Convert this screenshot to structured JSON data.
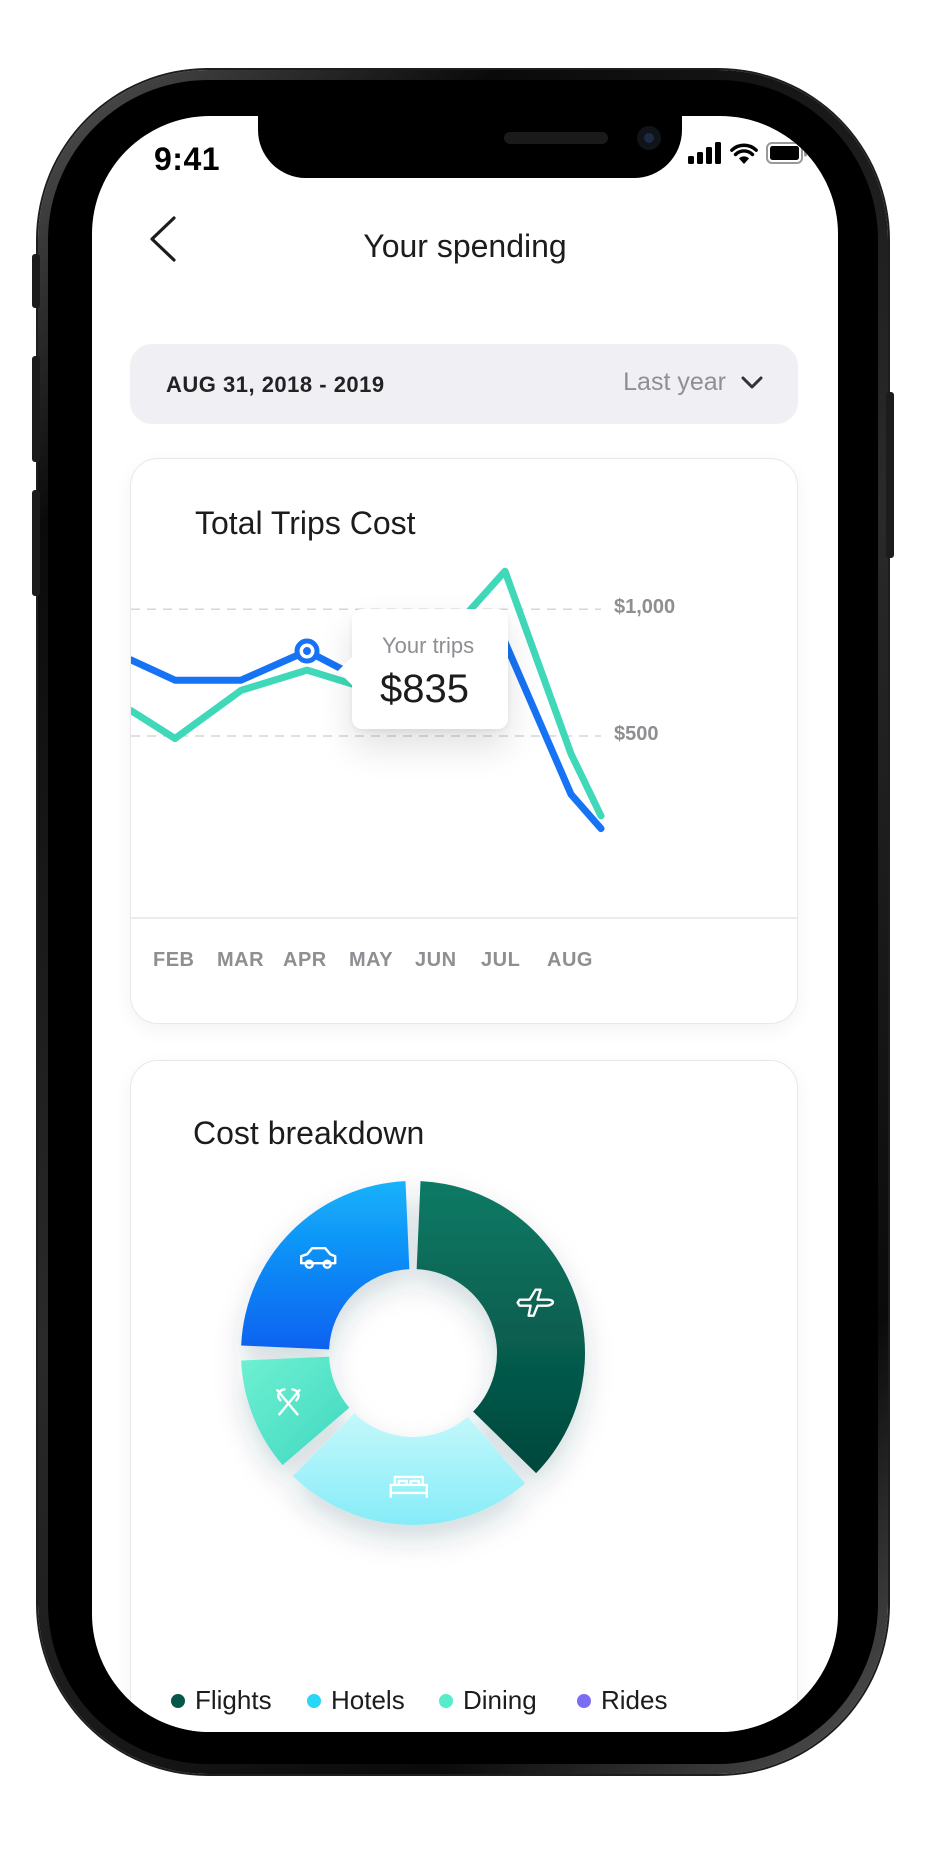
{
  "status_bar": {
    "time": "9:41"
  },
  "nav": {
    "title": "Your spending"
  },
  "date_range": {
    "label": "AUG 31, 2018 - 2019",
    "selected": "Last year"
  },
  "trips_card": {
    "title": "Total Trips Cost",
    "tooltip": {
      "label": "Your trips",
      "value": "$835"
    }
  },
  "breakdown_card": {
    "title": "Cost breakdown"
  },
  "colors": {
    "blue_line": "#1673f5",
    "teal_line": "#3fd8b8",
    "flights": "#05574a",
    "hotels": "#28d6f5",
    "dining": "#54ecc9",
    "rides": "#7b6cf6"
  },
  "icons": {
    "segments": [
      "cutlery-icon",
      "airplane-icon",
      "car-icon",
      "bed-icon"
    ]
  },
  "chart_data": [
    {
      "type": "line",
      "title": "Total Trips Cost",
      "categories": [
        "FEB",
        "MAR",
        "APR",
        "MAY",
        "JUN",
        "JUL",
        "AUG"
      ],
      "y_ticks": [
        "$500",
        "$1,000"
      ],
      "ylim": [
        0,
        1100
      ],
      "grid": true,
      "series": [
        {
          "values": [
            720,
            720,
            835,
            700,
            870,
            870,
            270
          ]
        },
        {
          "values": [
            490,
            680,
            760,
            680,
            860,
            1150,
            430
          ]
        }
      ],
      "tooltip_point": {
        "x": "APR",
        "y": 835
      }
    },
    {
      "type": "pie",
      "title": "Cost breakdown",
      "legend": [
        "Flights",
        "Hotels",
        "Dining",
        "Rides"
      ],
      "slices": [
        {
          "name": "Flights",
          "value": 38
        },
        {
          "name": "Hotels",
          "value": 25
        },
        {
          "name": "Dining",
          "value": 12
        },
        {
          "name": "Rides",
          "value": 25
        }
      ]
    }
  ]
}
